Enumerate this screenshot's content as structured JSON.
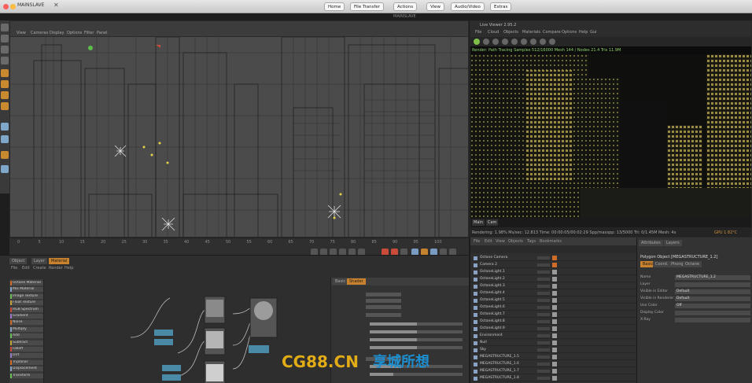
{
  "mac": {
    "title": "MAINSLAVE",
    "close": "✕",
    "subtitle": "MAINSLAVE",
    "toolbar": [
      {
        "label": "Home"
      },
      {
        "label": "File Transfer"
      },
      {
        "label": "Actions"
      },
      {
        "label": "View"
      },
      {
        "label": "Audio/Video"
      },
      {
        "label": "Extras"
      }
    ]
  },
  "viewport": {
    "menu": [
      "View",
      "Cameras",
      "Display",
      "Options",
      "Filter",
      "Panel"
    ]
  },
  "timeline": {
    "ticks": [
      "0",
      "5",
      "10",
      "15",
      "20",
      "25",
      "30",
      "35",
      "40",
      "45",
      "50",
      "55",
      "60",
      "65",
      "70",
      "75",
      "80",
      "85",
      "90",
      "95",
      "100"
    ]
  },
  "nodeeditor": {
    "tabs": [
      {
        "label": "Object",
        "active": false
      },
      {
        "label": "Layer",
        "active": false
      },
      {
        "label": "Material",
        "active": true
      }
    ],
    "menu": [
      "File",
      "Edit",
      "Create",
      "Render",
      "Help"
    ],
    "materials": [
      "Octane Material",
      "Mix Material",
      "Image Texture",
      "Float Texture",
      "RGB Spectrum",
      "Gradient",
      "Noise",
      "Multiply",
      "Add",
      "Subtract",
      "Falloff",
      "Dirt",
      "Triplanar",
      "Displacement",
      "Transform"
    ],
    "attr_tabs": [
      "Basic",
      "Shader"
    ]
  },
  "render": {
    "title": "Live Viewer 2.95.2",
    "menu": [
      "File",
      "Cloud",
      "Objects",
      "Materials",
      "Compare",
      "Options",
      "Help",
      "Gui"
    ],
    "status_line": "Render: Path Tracing  Samples 512/16000  Mesh 144 / Nodes 21.4  Tris 11.9M",
    "view_buttons": [
      "Main",
      "Cam"
    ],
    "status": "Rendering: 1.98%   Ms/sec: 12.813   Time: 00:00:05/00:02:29   Spp/maxspp: 13/5000   Tri: 0/1.45M   Mesh: 4x",
    "nums": "GPU 1  82°C"
  },
  "objects": {
    "header": [
      "File",
      "Edit",
      "View",
      "Objects",
      "Tags",
      "Bookmarks"
    ],
    "rows": [
      "Octane Camera",
      "Camera 2",
      "OctaneLight.1",
      "OctaneLight.2",
      "OctaneLight.3",
      "OctaneLight.4",
      "OctaneLight.5",
      "OctaneLight.6",
      "OctaneLight.7",
      "OctaneLight.8",
      "OctaneLight.9",
      "Environment",
      "Null",
      "Sky",
      "MEGASTRUCTURE_1.5",
      "MEGASTRUCTURE_1.6",
      "MEGASTRUCTURE_1.7",
      "MEGASTRUCTURE_1.8"
    ]
  },
  "props": {
    "tabs": [
      "Attributes",
      "Layers"
    ],
    "title": "Polygon Object [MEGASTRUCTURE_1.2]",
    "tabs2": [
      "Basic",
      "Coord.",
      "Phong",
      "Octane"
    ],
    "rows": [
      {
        "label": "Name",
        "value": "MEGASTRUCTURE_1.2"
      },
      {
        "label": "Layer",
        "value": ""
      },
      {
        "label": "Visible in Editor",
        "value": "Default"
      },
      {
        "label": "Visible in Renderer",
        "value": "Default"
      },
      {
        "label": "Use Color",
        "value": "Off"
      },
      {
        "label": "Display Color",
        "value": ""
      },
      {
        "label": "X-Ray",
        "value": ""
      }
    ]
  },
  "watermark": {
    "text": "CG88.CN",
    "tail": "享城所想"
  },
  "colors": {
    "accent": "#c8822e",
    "mac_red": "#fc605c",
    "mac_yellow": "#fdbc40",
    "mac_green": "#34c84a",
    "render_green": "#8fd16b"
  }
}
